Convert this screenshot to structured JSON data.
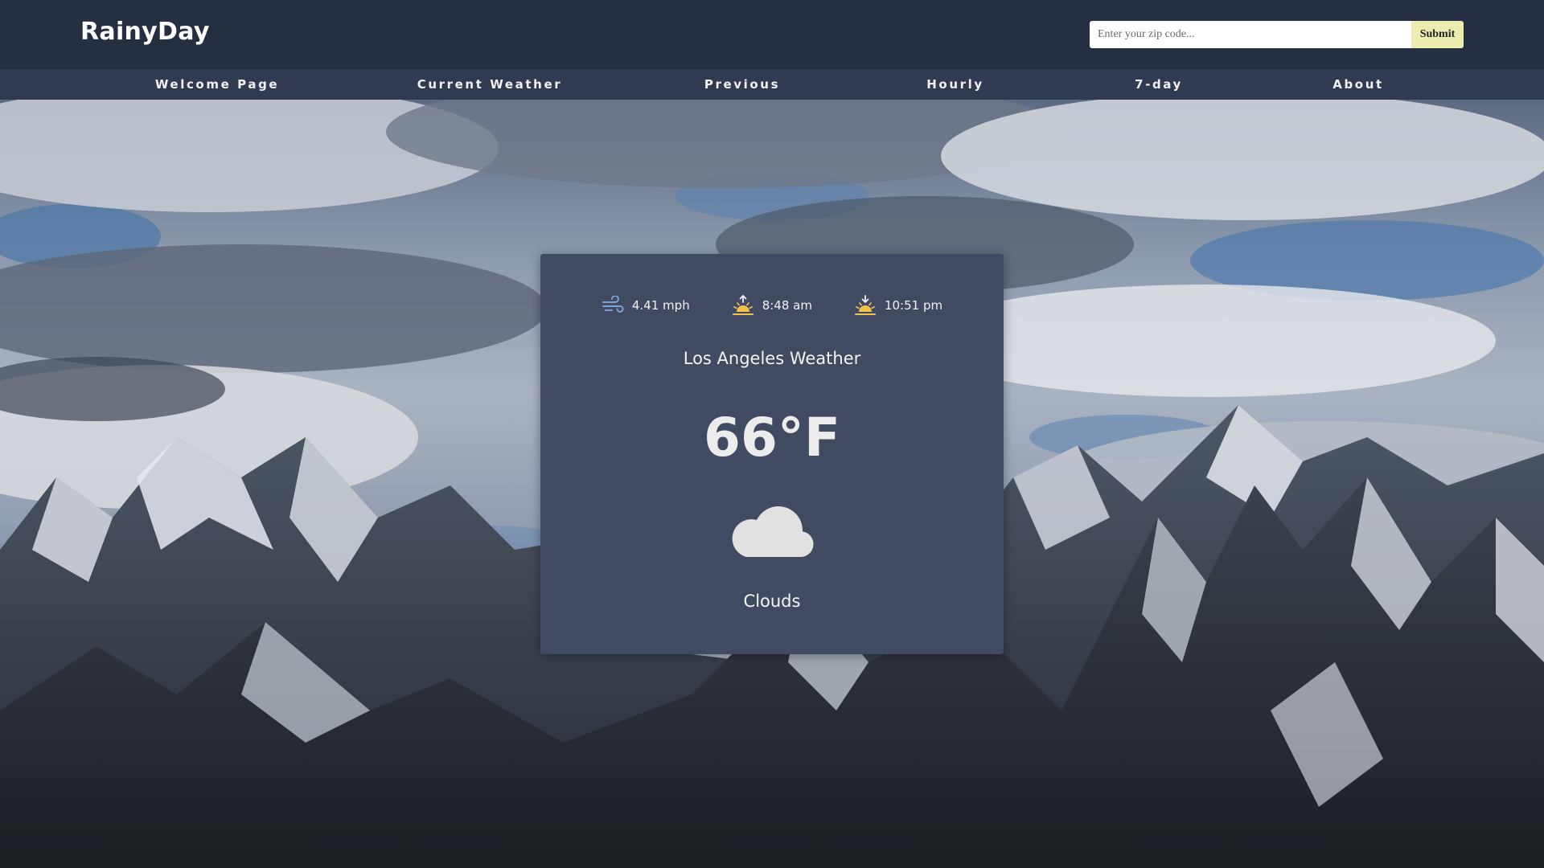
{
  "header": {
    "brand": "RainyDay",
    "search": {
      "placeholder": "Enter your zip code...",
      "value": ""
    },
    "submit_label": "Submit"
  },
  "nav": {
    "items": [
      {
        "label": "Welcome Page"
      },
      {
        "label": "Current Weather"
      },
      {
        "label": "Previous"
      },
      {
        "label": "Hourly"
      },
      {
        "label": "7-day"
      },
      {
        "label": "About"
      }
    ]
  },
  "weather": {
    "wind": "4.41 mph",
    "sunrise": "8:48 am",
    "sunset": "10:51 pm",
    "city_title": "Los Angeles Weather",
    "temperature": "66°F",
    "condition": "Clouds",
    "icons": {
      "wind": "wind-icon",
      "sunrise": "sunrise-icon",
      "sunset": "sunset-icon",
      "condition": "cloud-icon"
    }
  },
  "colors": {
    "header_bg": "#262e41",
    "nav_bg": "#303a51",
    "card_bg": "#404b61",
    "submit_bg": "#ecebb0",
    "sun_accent": "#f2c14e",
    "wind_accent": "#7fa2d6"
  }
}
